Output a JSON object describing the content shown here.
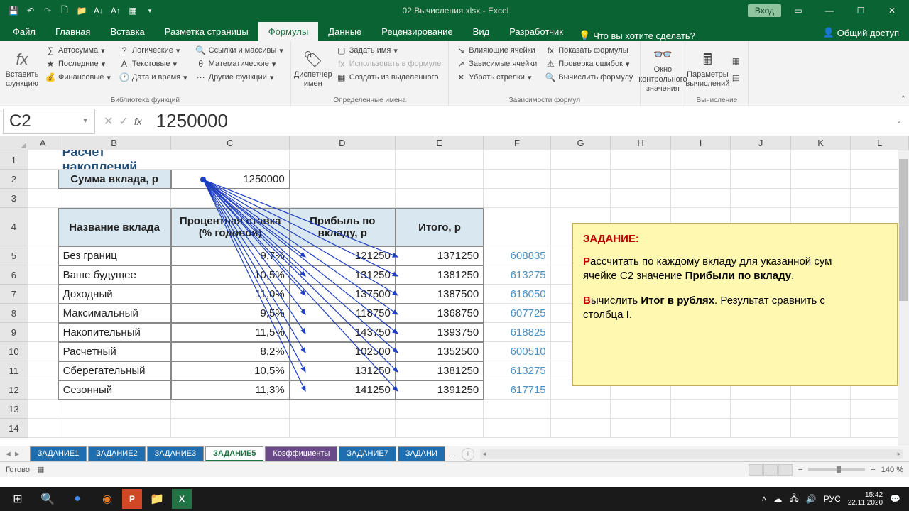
{
  "app": {
    "title": "02 Вычисления.xlsx - Excel",
    "login": "Вход"
  },
  "qat": [
    "save",
    "undo",
    "redo",
    "new",
    "open",
    "sort-asc",
    "sort-desc",
    "filter",
    "more"
  ],
  "tabs": {
    "file": "Файл",
    "list": [
      "Главная",
      "Вставка",
      "Разметка страницы",
      "Формулы",
      "Данные",
      "Рецензирование",
      "Вид",
      "Разработчик"
    ],
    "active": "Формулы",
    "search": "Что вы хотите сделать?",
    "share": "Общий доступ"
  },
  "ribbon": {
    "insertfn": "Вставить\nфункцию",
    "lib": {
      "autosum": "Автосумма",
      "recent": "Последние",
      "financial": "Финансовые",
      "logical": "Логические",
      "text": "Текстовые",
      "datetime": "Дата и время",
      "lookup": "Ссылки и массивы",
      "math": "Математические",
      "more": "Другие функции",
      "label": "Библиотека функций"
    },
    "namemgr": "Диспетчер\nимен",
    "names": {
      "define": "Задать имя",
      "use": "Использовать в формуле",
      "create": "Создать из выделенного",
      "label": "Определенные имена"
    },
    "audit": {
      "precedents": "Влияющие ячейки",
      "dependents": "Зависимые ячейки",
      "remove": "Убрать стрелки",
      "showf": "Показать формулы",
      "check": "Проверка ошибок",
      "eval": "Вычислить формулу",
      "label": "Зависимости формул"
    },
    "watch": "Окно контрольного\nзначения",
    "calc": {
      "options": "Параметры\nвычислений",
      "label": "Вычисление"
    }
  },
  "fbar": {
    "name": "C2",
    "value": "1250000"
  },
  "cols": [
    "A",
    "B",
    "C",
    "D",
    "E",
    "F",
    "G",
    "H",
    "I",
    "J",
    "K",
    "L"
  ],
  "rows": [
    "1",
    "2",
    "3",
    "4",
    "5",
    "6",
    "7",
    "8",
    "9",
    "10",
    "11",
    "12",
    "13",
    "14"
  ],
  "sheet": {
    "title": "Расчет накоплений",
    "deposit_label": "Сумма вклада, р",
    "deposit_value": "1250000",
    "hdr": {
      "name": "Название вклада",
      "rate": "Процентная ставка (% годовой)",
      "profit": "Прибыль по вкладу, р",
      "total": "Итого, р"
    },
    "rows": [
      {
        "name": "Без границ",
        "rate": "9,7%",
        "profit": "121250",
        "total": "1371250",
        "f": "608835"
      },
      {
        "name": "Ваше будущее",
        "rate": "10,5%",
        "profit": "131250",
        "total": "1381250",
        "f": "613275"
      },
      {
        "name": "Доходный",
        "rate": "11,0%",
        "profit": "137500",
        "total": "1387500",
        "f": "616050"
      },
      {
        "name": "Максимальный",
        "rate": "9,5%",
        "profit": "118750",
        "total": "1368750",
        "f": "607725"
      },
      {
        "name": "Накопительный",
        "rate": "11,5%",
        "profit": "143750",
        "total": "1393750",
        "f": "618825"
      },
      {
        "name": "Расчетный",
        "rate": "8,2%",
        "profit": "102500",
        "total": "1352500",
        "f": "600510"
      },
      {
        "name": "Сберегательный",
        "rate": "10,5%",
        "profit": "131250",
        "total": "1381250",
        "f": "613275"
      },
      {
        "name": "Сезонный",
        "rate": "11,3%",
        "profit": "141250",
        "total": "1391250",
        "f": "617715"
      }
    ]
  },
  "task": {
    "title": "ЗАДАНИЕ:",
    "p1a": "Р",
    "p1b": "ассчитать по каждому вкладу для указанной сум",
    "p1c": "ячейке С2 значение ",
    "p1d": "Прибыли по вкладу",
    "p1e": ".",
    "p2a": "В",
    "p2b": "ычислить ",
    "p2c": "Итог в рублях",
    "p2d": ". Результат сравнить с",
    "p2e": "столбца I."
  },
  "sheets": {
    "list": [
      "ЗАДАНИЕ1",
      "ЗАДАНИЕ2",
      "ЗАДАНИЕ3",
      "ЗАДАНИЕ5",
      "Коэффициенты",
      "ЗАДАНИЕ7",
      "ЗАДАНИ"
    ],
    "active": "ЗАДАНИЕ5"
  },
  "status": {
    "ready": "Готово",
    "zoom": "140 %"
  },
  "clock": {
    "time": "15:42",
    "date": "22.11.2020"
  }
}
